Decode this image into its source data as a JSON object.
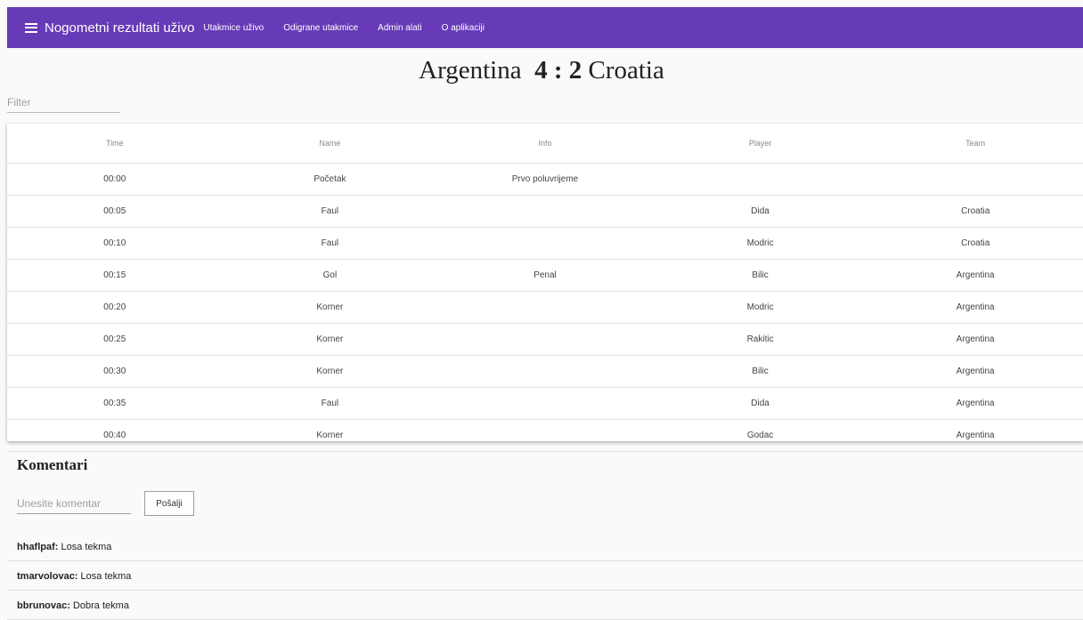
{
  "toolbar": {
    "title": "Nogometni rezultati uživo",
    "links": [
      "Utakmice uživo",
      "Odigrane utakmice",
      "Admin alati",
      "O aplikaciji"
    ],
    "color": "#673ab7",
    "menu_icon": "hamburger-menu-icon"
  },
  "match": {
    "home": "Argentina",
    "home_score": "4",
    "separator": ":",
    "away_score": "2",
    "away": "Croatia"
  },
  "filter": {
    "placeholder": "Filter"
  },
  "table": {
    "headers": [
      "Time",
      "Name",
      "Info",
      "Player",
      "Team"
    ],
    "rows": [
      [
        "00:00",
        "Početak",
        "Prvo poluvrijeme",
        "",
        ""
      ],
      [
        "00:05",
        "Faul",
        "",
        "Dida",
        "Croatia"
      ],
      [
        "00:10",
        "Faul",
        "",
        "Modric",
        "Croatia"
      ],
      [
        "00:15",
        "Gol",
        "Penal",
        "Bilic",
        "Argentina"
      ],
      [
        "00:20",
        "Korner",
        "",
        "Modric",
        "Argentina"
      ],
      [
        "00:25",
        "Korner",
        "",
        "Rakitic",
        "Argentina"
      ],
      [
        "00:30",
        "Korner",
        "",
        "Bilic",
        "Argentina"
      ],
      [
        "00:35",
        "Faul",
        "",
        "Dida",
        "Argentina"
      ],
      [
        "00:40",
        "Korner",
        "",
        "Godac",
        "Argentina"
      ]
    ]
  },
  "comments_section": {
    "title": "Komentari",
    "input_placeholder": "Unesite komentar",
    "send_label": "Pošalji",
    "comments": [
      {
        "user": "hhaflpaf:",
        "text": "Losa tekma"
      },
      {
        "user": "tmarvolovac:",
        "text": "Losa tekma"
      },
      {
        "user": "bbrunovac:",
        "text": "Dobra tekma"
      }
    ]
  }
}
